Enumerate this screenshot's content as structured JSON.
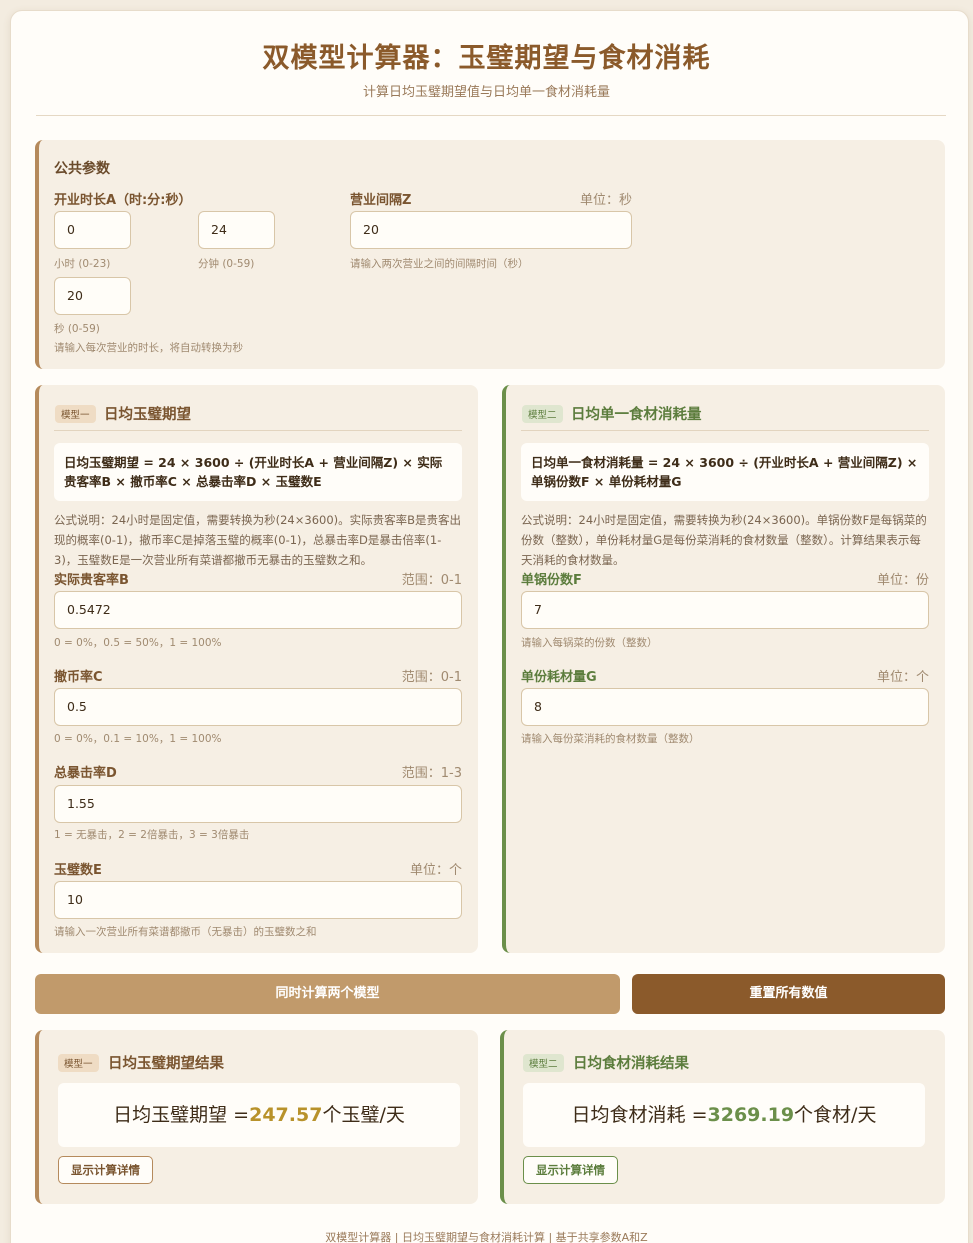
{
  "header": {
    "title": "双模型计算器：玉璧期望与食材消耗",
    "subtitle": "计算日均玉璧期望值与日均单一食材消耗量"
  },
  "common": {
    "title": "公共参数",
    "duration_label": "开业时长A（时:分:秒）",
    "hours": {
      "value": "0",
      "hint": "小时 (0-23)"
    },
    "minutes": {
      "value": "24",
      "hint": "分钟 (0-59)"
    },
    "seconds": {
      "value": "20",
      "hint": "秒 (0-59)"
    },
    "duration_hint": "请输入每次营业的时长，将自动转换为秒",
    "interval_label": "营业间隔Z",
    "interval_unit": "单位：秒",
    "interval_value": "20",
    "interval_hint": "请输入两次营业之间的间隔时间（秒）"
  },
  "model1": {
    "badge": "模型一",
    "title": "日均玉璧期望",
    "formula": "日均玉璧期望 = 24 × 3600 ÷ (开业时长A + 营业间隔Z) × 实际贵客率B × 撤币率C × 总暴击率D × 玉璧数E",
    "desc": "公式说明：24小时是固定值，需要转换为秒(24×3600)。实际贵客率B是贵客出现的概率(0-1)，撤币率C是掉落玉璧的概率(0-1)，总暴击率D是暴击倍率(1-3)，玉璧数E是一次营业所有菜谱都撤币无暴击的玉璧数之和。",
    "fields": [
      {
        "label": "实际贵客率B",
        "meta": "范围：0-1",
        "value": "0.5472",
        "hint": "0 = 0%，0.5 = 50%，1 = 100%"
      },
      {
        "label": "撤币率C",
        "meta": "范围：0-1",
        "value": "0.5",
        "hint": "0 = 0%，0.1 = 10%，1 = 100%"
      },
      {
        "label": "总暴击率D",
        "meta": "范围：1-3",
        "value": "1.55",
        "hint": "1 = 无暴击，2 = 2倍暴击，3 = 3倍暴击"
      },
      {
        "label": "玉璧数E",
        "meta": "单位：个",
        "value": "10",
        "hint": "请输入一次营业所有菜谱都撤币（无暴击）的玉璧数之和"
      }
    ]
  },
  "model2": {
    "badge": "模型二",
    "title": "日均单一食材消耗量",
    "formula": "日均单一食材消耗量 = 24 × 3600 ÷ (开业时长A + 营业间隔Z) × 单锅份数F × 单份耗材量G",
    "desc": "公式说明：24小时是固定值，需要转换为秒(24×3600)。单锅份数F是每锅菜的份数（整数），单份耗材量G是每份菜消耗的食材数量（整数）。计算结果表示每天消耗的食材数量。",
    "fields": [
      {
        "label": "单锅份数F",
        "meta": "单位：份",
        "value": "7",
        "hint": "请输入每锅菜的份数（整数）"
      },
      {
        "label": "单份耗材量G",
        "meta": "单位：个",
        "value": "8",
        "hint": "请输入每份菜消耗的食材数量（整数）"
      }
    ]
  },
  "actions": {
    "calculate": "同时计算两个模型",
    "reset": "重置所有数值"
  },
  "result1": {
    "badge": "模型一",
    "title": "日均玉璧期望结果",
    "prefix": "日均玉璧期望 =",
    "value": "247.57",
    "suffix": "个玉璧/天",
    "detail_button": "显示计算详情"
  },
  "result2": {
    "badge": "模型二",
    "title": "日均食材消耗结果",
    "prefix": "日均食材消耗 =",
    "value": "3269.19",
    "suffix": "个食材/天",
    "detail_button": "显示计算详情"
  },
  "footer": "双模型计算器 | 日均玉璧期望与食材消耗计算 | 基于共享参数A和Z"
}
